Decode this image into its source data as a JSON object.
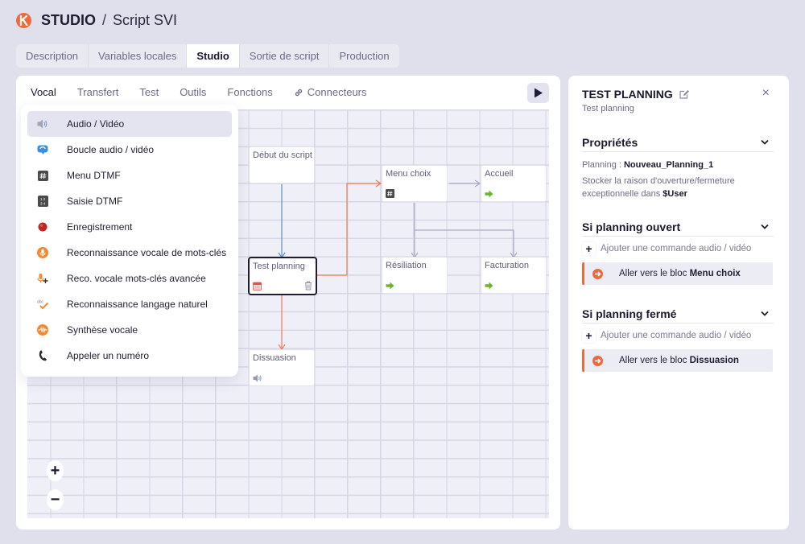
{
  "header": {
    "brand": "STUDIO",
    "separator": "/",
    "title": "Script SVI"
  },
  "tabs": [
    {
      "label": "Description",
      "active": false
    },
    {
      "label": "Variables locales",
      "active": false
    },
    {
      "label": "Studio",
      "active": true
    },
    {
      "label": "Sortie de script",
      "active": false
    },
    {
      "label": "Production",
      "active": false
    }
  ],
  "subtabs": [
    {
      "label": "Vocal",
      "active": true
    },
    {
      "label": "Transfert",
      "active": false
    },
    {
      "label": "Test",
      "active": false
    },
    {
      "label": "Outils",
      "active": false
    },
    {
      "label": "Fonctions",
      "active": false
    },
    {
      "label": "Connecteurs",
      "active": false,
      "icon": "link-icon"
    }
  ],
  "toolbar": {
    "play_icon": "play-icon"
  },
  "menu": {
    "items": [
      {
        "label": "Audio / Vidéo",
        "icon": "speaker-icon",
        "active": true
      },
      {
        "label": "Boucle audio / vidéo",
        "icon": "loop-icon",
        "active": false
      },
      {
        "label": "Menu DTMF",
        "icon": "hash-keypad-icon",
        "active": false
      },
      {
        "label": "Saisie DTMF",
        "icon": "numeric-keypad-icon",
        "active": false
      },
      {
        "label": "Enregistrement",
        "icon": "record-icon",
        "active": false
      },
      {
        "label": "Reconnaissance vocale de mots-clés",
        "icon": "microphone-icon",
        "active": false
      },
      {
        "label": "Reco. vocale mots-clés avancée",
        "icon": "microphone-plus-icon",
        "active": false
      },
      {
        "label": "Reconnaissance langage naturel",
        "icon": "abc-check-icon",
        "active": false
      },
      {
        "label": "Synthèse vocale",
        "icon": "waveform-icon",
        "active": false
      },
      {
        "label": "Appeler un numéro",
        "icon": "phone-icon",
        "active": false
      }
    ]
  },
  "flow": {
    "nodes": [
      {
        "id": "debut",
        "label": "Début du script",
        "icon": null,
        "selected": false
      },
      {
        "id": "menu",
        "label": "Menu choix",
        "icon": "hash-keypad-icon",
        "selected": false
      },
      {
        "id": "accueil",
        "label": "Accueil",
        "icon": "green-arrow-icon",
        "selected": false
      },
      {
        "id": "test",
        "label": "Test planning",
        "icon": "calendar-icon",
        "selected": true
      },
      {
        "id": "resiliation",
        "label": "Résiliation",
        "icon": "green-arrow-icon",
        "selected": false
      },
      {
        "id": "facturation",
        "label": "Facturation",
        "icon": "green-arrow-icon",
        "selected": false
      },
      {
        "id": "dissuasion",
        "label": "Dissuasion",
        "icon": "speaker-icon",
        "selected": false
      }
    ],
    "edges": [
      {
        "from": "debut",
        "to": "test",
        "color": "#5b8fc9"
      },
      {
        "from": "test",
        "to": "menu",
        "color": "#ee7a55"
      },
      {
        "from": "test",
        "to": "dissuasion",
        "color": "#ee7a55"
      },
      {
        "from": "menu",
        "to": "accueil",
        "color": "#a9a9c4"
      },
      {
        "from": "menu",
        "to": "resiliation",
        "color": "#a9a9c4"
      },
      {
        "from": "menu",
        "to": "facturation",
        "color": "#a9a9c4"
      }
    ],
    "zoom_in": "+",
    "zoom_out": "−"
  },
  "panel": {
    "title": "TEST PLANNING",
    "subtitle": "Test planning",
    "close": "×",
    "properties": {
      "heading": "Propriétés",
      "planning_label": "Planning : ",
      "planning_value": "Nouveau_Planning_1",
      "store_text": "Stocker la raison d'ouverture/fermeture exceptionnelle dans ",
      "store_var": "$User"
    },
    "open": {
      "heading": "Si planning ouvert",
      "add_label": "Ajouter une commande audio / vidéo",
      "goto_prefix": "Aller vers le bloc ",
      "goto_target": "Menu choix"
    },
    "closed": {
      "heading": "Si planning fermé",
      "add_label": "Ajouter une commande audio / vidéo",
      "goto_prefix": "Aller vers le bloc ",
      "goto_target": "Dissuasion"
    }
  },
  "colors": {
    "accent": "#ee6a3c",
    "background": "#dfe0ec",
    "selected_border": "#1e1e30"
  }
}
